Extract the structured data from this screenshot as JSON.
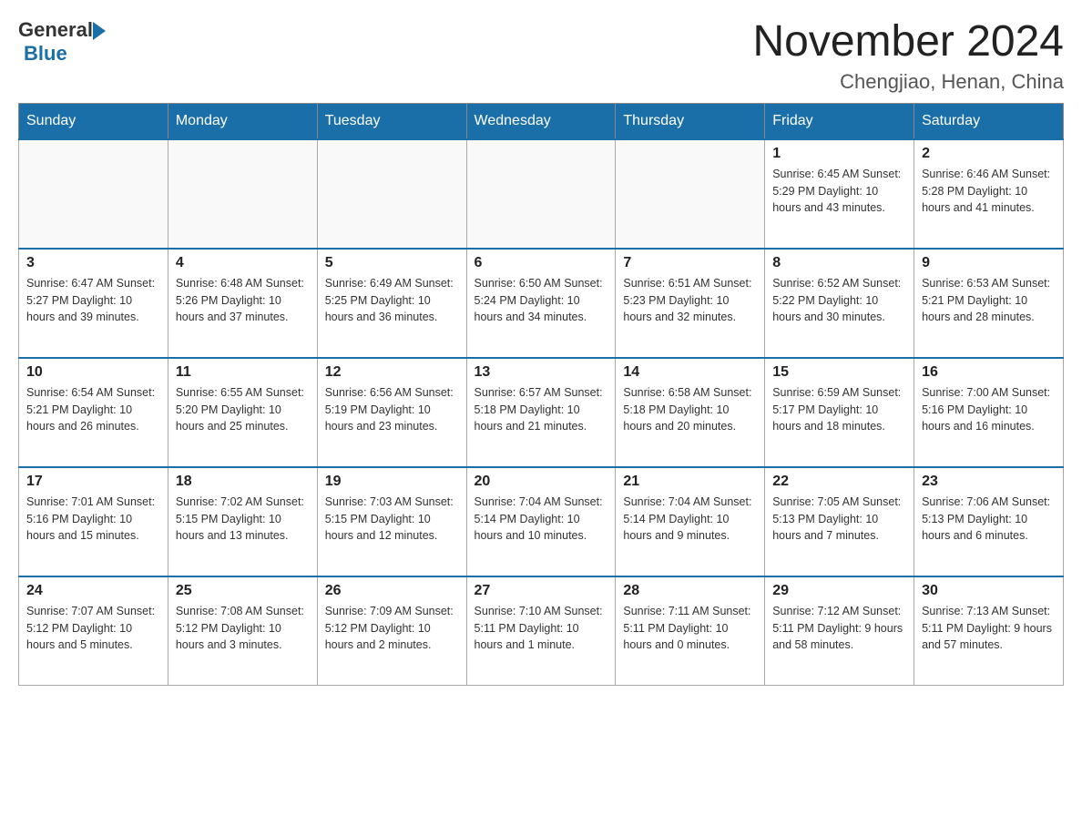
{
  "header": {
    "logo_general": "General",
    "logo_blue": "Blue",
    "month_title": "November 2024",
    "location": "Chengjiao, Henan, China"
  },
  "days_of_week": [
    "Sunday",
    "Monday",
    "Tuesday",
    "Wednesday",
    "Thursday",
    "Friday",
    "Saturday"
  ],
  "weeks": [
    {
      "days": [
        {
          "number": "",
          "info": ""
        },
        {
          "number": "",
          "info": ""
        },
        {
          "number": "",
          "info": ""
        },
        {
          "number": "",
          "info": ""
        },
        {
          "number": "",
          "info": ""
        },
        {
          "number": "1",
          "info": "Sunrise: 6:45 AM\nSunset: 5:29 PM\nDaylight: 10 hours and 43 minutes."
        },
        {
          "number": "2",
          "info": "Sunrise: 6:46 AM\nSunset: 5:28 PM\nDaylight: 10 hours and 41 minutes."
        }
      ]
    },
    {
      "days": [
        {
          "number": "3",
          "info": "Sunrise: 6:47 AM\nSunset: 5:27 PM\nDaylight: 10 hours and 39 minutes."
        },
        {
          "number": "4",
          "info": "Sunrise: 6:48 AM\nSunset: 5:26 PM\nDaylight: 10 hours and 37 minutes."
        },
        {
          "number": "5",
          "info": "Sunrise: 6:49 AM\nSunset: 5:25 PM\nDaylight: 10 hours and 36 minutes."
        },
        {
          "number": "6",
          "info": "Sunrise: 6:50 AM\nSunset: 5:24 PM\nDaylight: 10 hours and 34 minutes."
        },
        {
          "number": "7",
          "info": "Sunrise: 6:51 AM\nSunset: 5:23 PM\nDaylight: 10 hours and 32 minutes."
        },
        {
          "number": "8",
          "info": "Sunrise: 6:52 AM\nSunset: 5:22 PM\nDaylight: 10 hours and 30 minutes."
        },
        {
          "number": "9",
          "info": "Sunrise: 6:53 AM\nSunset: 5:21 PM\nDaylight: 10 hours and 28 minutes."
        }
      ]
    },
    {
      "days": [
        {
          "number": "10",
          "info": "Sunrise: 6:54 AM\nSunset: 5:21 PM\nDaylight: 10 hours and 26 minutes."
        },
        {
          "number": "11",
          "info": "Sunrise: 6:55 AM\nSunset: 5:20 PM\nDaylight: 10 hours and 25 minutes."
        },
        {
          "number": "12",
          "info": "Sunrise: 6:56 AM\nSunset: 5:19 PM\nDaylight: 10 hours and 23 minutes."
        },
        {
          "number": "13",
          "info": "Sunrise: 6:57 AM\nSunset: 5:18 PM\nDaylight: 10 hours and 21 minutes."
        },
        {
          "number": "14",
          "info": "Sunrise: 6:58 AM\nSunset: 5:18 PM\nDaylight: 10 hours and 20 minutes."
        },
        {
          "number": "15",
          "info": "Sunrise: 6:59 AM\nSunset: 5:17 PM\nDaylight: 10 hours and 18 minutes."
        },
        {
          "number": "16",
          "info": "Sunrise: 7:00 AM\nSunset: 5:16 PM\nDaylight: 10 hours and 16 minutes."
        }
      ]
    },
    {
      "days": [
        {
          "number": "17",
          "info": "Sunrise: 7:01 AM\nSunset: 5:16 PM\nDaylight: 10 hours and 15 minutes."
        },
        {
          "number": "18",
          "info": "Sunrise: 7:02 AM\nSunset: 5:15 PM\nDaylight: 10 hours and 13 minutes."
        },
        {
          "number": "19",
          "info": "Sunrise: 7:03 AM\nSunset: 5:15 PM\nDaylight: 10 hours and 12 minutes."
        },
        {
          "number": "20",
          "info": "Sunrise: 7:04 AM\nSunset: 5:14 PM\nDaylight: 10 hours and 10 minutes."
        },
        {
          "number": "21",
          "info": "Sunrise: 7:04 AM\nSunset: 5:14 PM\nDaylight: 10 hours and 9 minutes."
        },
        {
          "number": "22",
          "info": "Sunrise: 7:05 AM\nSunset: 5:13 PM\nDaylight: 10 hours and 7 minutes."
        },
        {
          "number": "23",
          "info": "Sunrise: 7:06 AM\nSunset: 5:13 PM\nDaylight: 10 hours and 6 minutes."
        }
      ]
    },
    {
      "days": [
        {
          "number": "24",
          "info": "Sunrise: 7:07 AM\nSunset: 5:12 PM\nDaylight: 10 hours and 5 minutes."
        },
        {
          "number": "25",
          "info": "Sunrise: 7:08 AM\nSunset: 5:12 PM\nDaylight: 10 hours and 3 minutes."
        },
        {
          "number": "26",
          "info": "Sunrise: 7:09 AM\nSunset: 5:12 PM\nDaylight: 10 hours and 2 minutes."
        },
        {
          "number": "27",
          "info": "Sunrise: 7:10 AM\nSunset: 5:11 PM\nDaylight: 10 hours and 1 minute."
        },
        {
          "number": "28",
          "info": "Sunrise: 7:11 AM\nSunset: 5:11 PM\nDaylight: 10 hours and 0 minutes."
        },
        {
          "number": "29",
          "info": "Sunrise: 7:12 AM\nSunset: 5:11 PM\nDaylight: 9 hours and 58 minutes."
        },
        {
          "number": "30",
          "info": "Sunrise: 7:13 AM\nSunset: 5:11 PM\nDaylight: 9 hours and 57 minutes."
        }
      ]
    }
  ]
}
